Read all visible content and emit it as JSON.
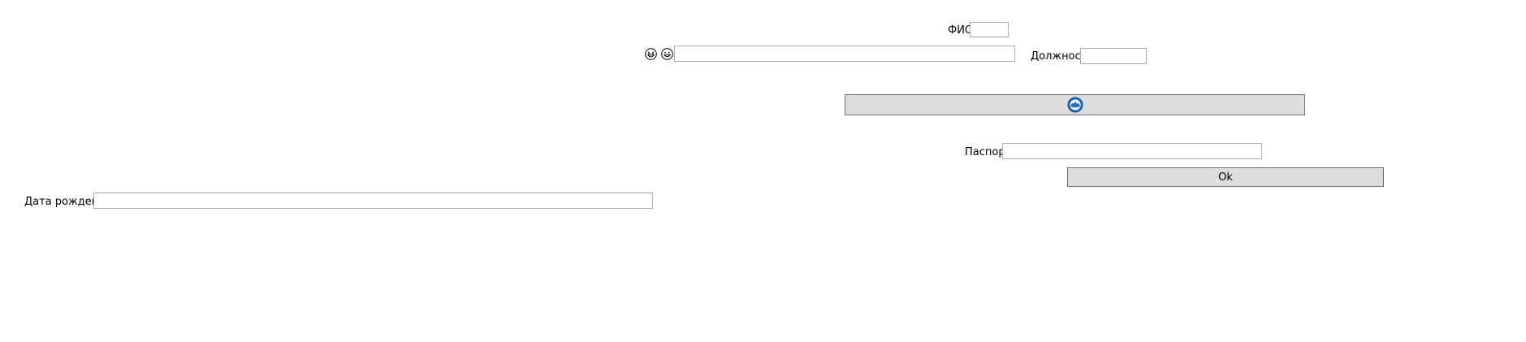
{
  "form": {
    "fio": {
      "label": "ФИО",
      "value": ""
    },
    "position": {
      "label": "Должность",
      "value": ""
    },
    "emoji_field": {
      "value": "",
      "icons": [
        "grinning-squint-face-icon",
        "grinning-face-icon"
      ]
    },
    "image_button": {
      "icon": "globe-icon",
      "icon_color": "#1e6fc8"
    },
    "passport": {
      "label": "Паспорт",
      "value": ""
    },
    "ok_button": {
      "label": "Ok"
    },
    "birth_date": {
      "label": "Дата рождения",
      "value": ""
    }
  }
}
